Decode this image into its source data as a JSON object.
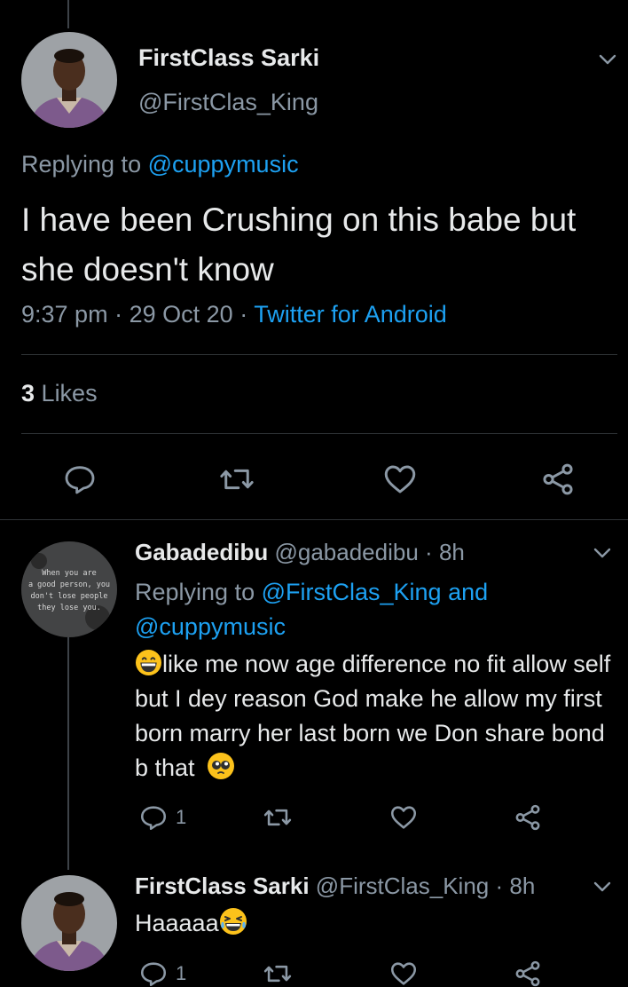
{
  "main_tweet": {
    "author_name": "FirstClass Sarki",
    "handle": "@FirstClas_King",
    "replying_prefix": "Replying to",
    "replying_to": "@cuppymusic",
    "text": "I have been Crushing on this babe but she doesn't know",
    "time": "9:37 pm",
    "date": "29 Oct 20",
    "separator": "·",
    "source": "Twitter for Android",
    "likes_count": "3",
    "likes_label": "Likes"
  },
  "replies": [
    {
      "author_name": "Gabadedibu",
      "handle": "@gabadedibu",
      "time": "8h",
      "replying_prefix": "Replying to",
      "replying_to_1": "@FirstClas_King",
      "replying_and": "and",
      "replying_to_2": "@cuppymusic",
      "text": "like me now age difference no fit allow self but I dey reason God make he allow my first born marry her last born we Don share bond b that",
      "reply_count": "1",
      "avatar_text": [
        "When you are",
        "a good person, you",
        "don't lose people",
        "they lose you."
      ]
    },
    {
      "author_name": "FirstClass Sarki",
      "handle": "@FirstClas_King",
      "time": "8h",
      "text": "Haaaaa",
      "reply_count": "1"
    }
  ],
  "colors": {
    "background": "#000000",
    "text_primary": "#e7e9ea",
    "text_secondary": "#8b98a5",
    "link": "#1da1f2",
    "divider": "#2f3336"
  },
  "icons": [
    "chevron-down-icon",
    "reply-icon",
    "retweet-icon",
    "like-icon",
    "share-icon",
    "grinning-emoji-icon",
    "pleading-emoji-icon",
    "laughing-emoji-icon"
  ]
}
